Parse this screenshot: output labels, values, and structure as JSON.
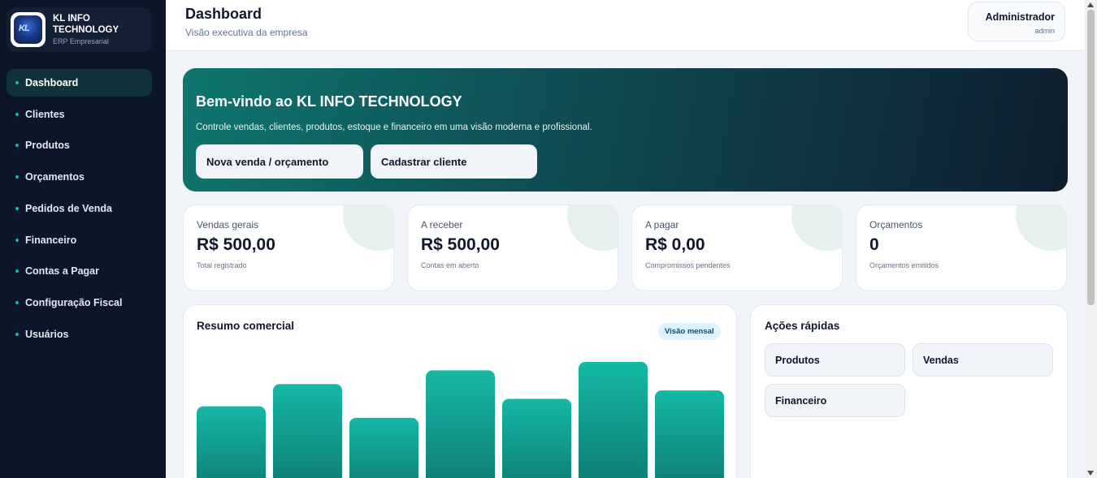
{
  "brand": {
    "name": "KL INFO TECHNOLOGY",
    "subtitle": "ERP Empresarial",
    "logo_text": "KL"
  },
  "sidebar": {
    "items": [
      {
        "label": "Dashboard",
        "active": true
      },
      {
        "label": "Clientes",
        "active": false
      },
      {
        "label": "Produtos",
        "active": false
      },
      {
        "label": "Orçamentos",
        "active": false
      },
      {
        "label": "Pedidos de Venda",
        "active": false
      },
      {
        "label": "Financeiro",
        "active": false
      },
      {
        "label": "Contas a Pagar",
        "active": false
      },
      {
        "label": "Configuração Fiscal",
        "active": false
      },
      {
        "label": "Usuários",
        "active": false
      }
    ]
  },
  "header": {
    "title": "Dashboard",
    "subtitle": "Visão executiva da empresa",
    "user_name": "Administrador",
    "user_role": "admin"
  },
  "hero": {
    "title": "Bem-vindo ao KL INFO TECHNOLOGY",
    "description": "Controle vendas, clientes, produtos, estoque e financeiro em uma visão moderna e profissional.",
    "primary_button": "Nova venda / orçamento",
    "secondary_button": "Cadastrar cliente"
  },
  "stats": [
    {
      "label": "Vendas gerais",
      "value": "R$ 500,00",
      "sub": "Total registrado"
    },
    {
      "label": "A receber",
      "value": "R$ 500,00",
      "sub": "Contas em aberto"
    },
    {
      "label": "A pagar",
      "value": "R$ 0,00",
      "sub": "Compromissos pendentes"
    },
    {
      "label": "Orçamentos",
      "value": "0",
      "sub": "Orçamentos emitidos"
    }
  ],
  "chart_section": {
    "title": "Resumo comercial",
    "badge": "Visão mensal"
  },
  "chart_data": {
    "type": "bar",
    "title": "Resumo comercial",
    "categories": [],
    "values": [
      58,
      79,
      47,
      92,
      65,
      100,
      73
    ],
    "ylim": [
      0,
      100
    ],
    "grid": false,
    "colors": {
      "bar_top": "#14b8a6",
      "bar_bottom": "#0f766e"
    }
  },
  "quick_actions": {
    "title": "Ações rápidas",
    "items": [
      "Produtos",
      "Vendas",
      "Financeiro"
    ]
  },
  "colors": {
    "accent": "#14b8a6",
    "sidebar_bg": "#0b1628",
    "page_bg": "#f1f5f9"
  }
}
